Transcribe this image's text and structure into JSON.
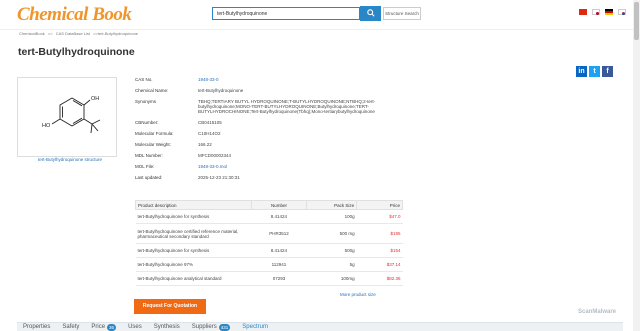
{
  "header": {
    "logo": "Chemical Book",
    "search_value": "tert-Butylhydroquinone",
    "structure_search_label": "Structure Search",
    "flags": [
      "cn-flag",
      "jp-flag",
      "de-flag",
      "kr-flag"
    ],
    "accent_color": "#2a87c7",
    "logo_color": "#f0952a"
  },
  "breadcrumb": [
    "ChemicalBook",
    ">>",
    "CAS DataBase List",
    ">>tert-Butylhydroquinone"
  ],
  "page_title": "tert-Butylhydroquinone",
  "social": [
    "linkedin-icon",
    "twitter-icon",
    "facebook-icon"
  ],
  "structure": {
    "link_label": "tert-Butylhydroquinone structure",
    "oh_top": "OH",
    "oh_left": "HO"
  },
  "properties": [
    {
      "label": "CAS No.",
      "value": "1948-33-0",
      "link": true
    },
    {
      "label": "Chemical Name:",
      "value": "tert-Butylhydroquinone",
      "link": false
    },
    {
      "label": "Synonyms",
      "value": "TBHQ;TERTIARY BUTYL HYDROQUINONE;T-BUTYLHYDROQUINONE;NTBHQ;2-tert-butylhydroquinone;MONO-TERT-BUTYLHYDROQUINONE;Butylhydroquinone;TERT-BUTYLHYDROCHINONE;Tert-Butylhydroquinone(Tbhq);Mono-tertiarybutylhydroquinone",
      "link": false
    },
    {
      "label": "CBNumber:",
      "value": "CB0415105",
      "link": false
    },
    {
      "label": "Molecular Formula:",
      "value": "C10H14O2",
      "link": false
    },
    {
      "label": "Molecular Weight:",
      "value": "166.22",
      "link": false
    },
    {
      "label": "MDL Number:",
      "value": "MFCD00002344",
      "link": false
    },
    {
      "label": "MOL File:",
      "value": "1948-33-0.mol",
      "link": true
    },
    {
      "label": "Last updated:",
      "value": "2025-12-23 21:30:31",
      "link": false
    }
  ],
  "products": {
    "headers": [
      "Product description",
      "Number",
      "Pack Size",
      "Price"
    ],
    "rows": [
      {
        "desc": "tert-Butylhydroquinone for synthesis",
        "num": "8.41424",
        "pack": "100g",
        "price": "$47.0"
      },
      {
        "desc": "tert-Butylhydroquinone certified reference material, pharmaceutical secondary standard",
        "num": "PHR3512",
        "pack": "500 mg",
        "price": "$195"
      },
      {
        "desc": "tert-Butylhydroquinone for synthesis",
        "num": "8.41424",
        "pack": "500g",
        "price": "$154"
      },
      {
        "desc": "tert-Butylhydroquinone 97%",
        "num": "112941",
        "pack": "5g",
        "price": "$37.14"
      },
      {
        "desc": "tert-Butylhydroquinone analytical standard",
        "num": "07293",
        "pack": "100mg",
        "price": "$82.36"
      }
    ],
    "more_label": "More product size"
  },
  "quote_button": "Request For Quotation",
  "tabs": [
    {
      "label": "Properties",
      "badge": "",
      "active": false
    },
    {
      "label": "Safety",
      "badge": "",
      "active": false
    },
    {
      "label": "Price",
      "badge": "36",
      "active": false
    },
    {
      "label": "Uses",
      "badge": "",
      "active": false
    },
    {
      "label": "Synthesis",
      "badge": "",
      "active": false
    },
    {
      "label": "Suppliers",
      "badge": "431",
      "active": false
    },
    {
      "label": "Spectrum",
      "badge": "",
      "active": true
    }
  ],
  "watermark": "ScanMalware"
}
